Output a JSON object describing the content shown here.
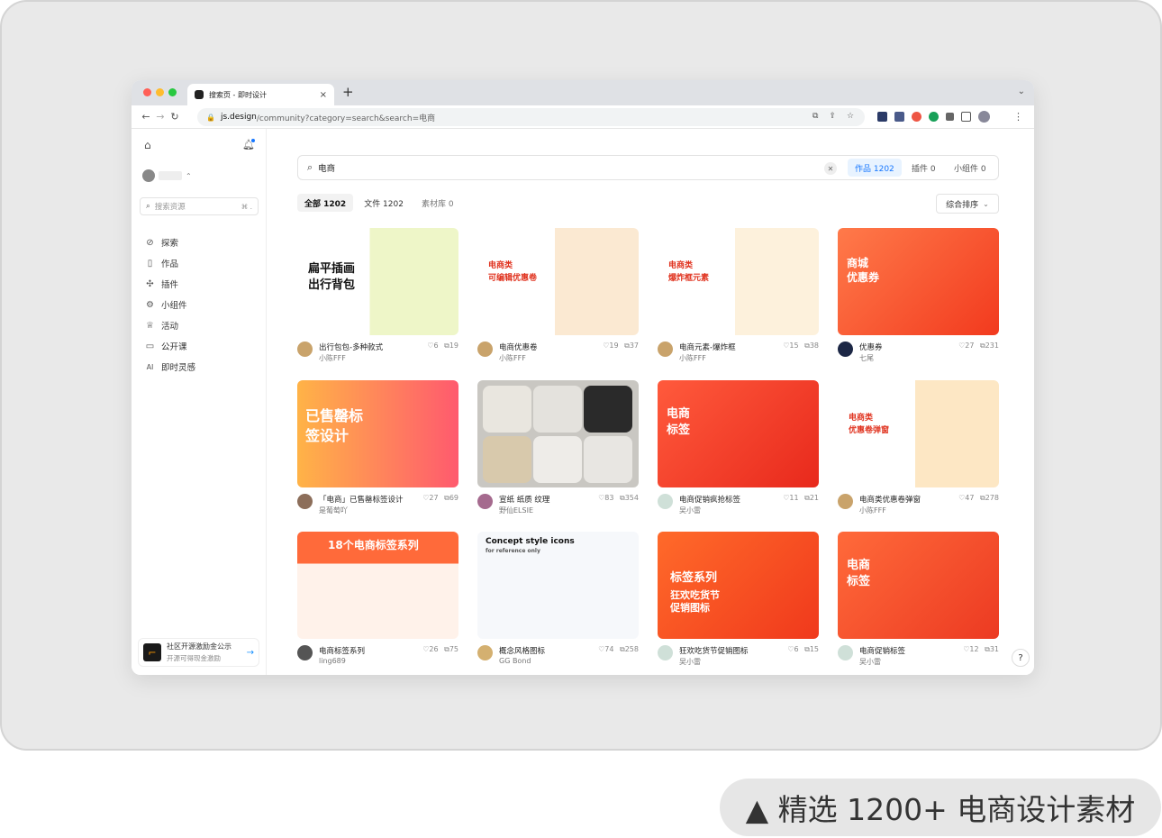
{
  "browser": {
    "tab_title": "搜索页 - 即时设计",
    "tab_close": "×",
    "new_tab": "+",
    "url_host": "js.design",
    "url_path": "/community?category=search&search=电商"
  },
  "sidebar": {
    "search_placeholder": "搜索资源",
    "search_shortcut": "⌘ .",
    "nav": [
      {
        "label": "探索",
        "icon": "explore-icon",
        "glyph": "⊘"
      },
      {
        "label": "作品",
        "icon": "file-icon",
        "glyph": "▯"
      },
      {
        "label": "插件",
        "icon": "plugin-icon",
        "glyph": "✣"
      },
      {
        "label": "小组件",
        "icon": "widget-icon",
        "glyph": "⚙"
      },
      {
        "label": "活动",
        "icon": "trophy-icon",
        "glyph": "♕"
      },
      {
        "label": "公开课",
        "icon": "book-icon",
        "glyph": "▭"
      },
      {
        "label": "即时灵感",
        "icon": "ai-icon",
        "glyph": "AI"
      }
    ],
    "promo_title": "社区开源激励金公示",
    "promo_subtitle": "开源可得现金激励"
  },
  "main": {
    "search_query": "电商",
    "search_types": [
      {
        "label": "作品 1202",
        "active": true
      },
      {
        "label": "插件 0",
        "active": false
      },
      {
        "label": "小组件 0",
        "active": false
      }
    ],
    "filters": [
      {
        "label": "全部 1202",
        "state": "on"
      },
      {
        "label": "文件 1202",
        "state": "normal"
      },
      {
        "label": "素材库 0",
        "state": "dim"
      }
    ],
    "sort_label": "综合排序"
  },
  "cards": [
    {
      "title": "出行包包-多种款式",
      "author": "小陈FFF",
      "likes": "6",
      "comments": "19",
      "thumb_text": [
        "扁平插画",
        "出行背包"
      ]
    },
    {
      "title": "电商优惠卷",
      "author": "小陈FFF",
      "likes": "19",
      "comments": "37",
      "thumb_text": [
        "电商类",
        "可编辑优惠卷"
      ]
    },
    {
      "title": "电商元素-爆炸框",
      "author": "小陈FFF",
      "likes": "15",
      "comments": "38",
      "thumb_text": [
        "电商类",
        "爆炸框元素"
      ]
    },
    {
      "title": "优惠券",
      "author": "七尾",
      "likes": "27",
      "comments": "231",
      "thumb_text": [
        "商城",
        "优惠券"
      ]
    },
    {
      "title": "「电商」已售罄标签设计",
      "author": "是葡萄吖",
      "likes": "27",
      "comments": "69",
      "thumb_text": [
        "已售罄标",
        "签设计"
      ]
    },
    {
      "title": "宣纸 纸质 纹理",
      "author": "野仙ELSIE",
      "likes": "83",
      "comments": "354",
      "thumb_text": []
    },
    {
      "title": "电商促销疯抢标签",
      "author": "吴小雷",
      "likes": "11",
      "comments": "21",
      "thumb_text": [
        "电商",
        "标签"
      ]
    },
    {
      "title": "电商类优惠卷弹窗",
      "author": "小陈FFF",
      "likes": "47",
      "comments": "278",
      "thumb_text": [
        "电商类",
        "优惠卷弹窗"
      ]
    },
    {
      "title": "电商标签系列",
      "author": "ling689",
      "likes": "26",
      "comments": "75",
      "thumb_text": [
        "18个电商标签系列"
      ]
    },
    {
      "title": "概念风格图标",
      "author": "GG Bond",
      "likes": "74",
      "comments": "258",
      "thumb_text": [
        "Concept style icons",
        "for reference only"
      ]
    },
    {
      "title": "狂欢吃货节促销图标",
      "author": "吴小雷",
      "likes": "6",
      "comments": "15",
      "thumb_text": [
        "标签系列",
        "狂欢吃货节",
        "促销图标"
      ]
    },
    {
      "title": "电商促销标签",
      "author": "吴小雷",
      "likes": "12",
      "comments": "31",
      "thumb_text": [
        "电商",
        "标签"
      ]
    }
  ],
  "help_label": "?",
  "caption": "▲ 精选 1200+ 电商设计素材"
}
